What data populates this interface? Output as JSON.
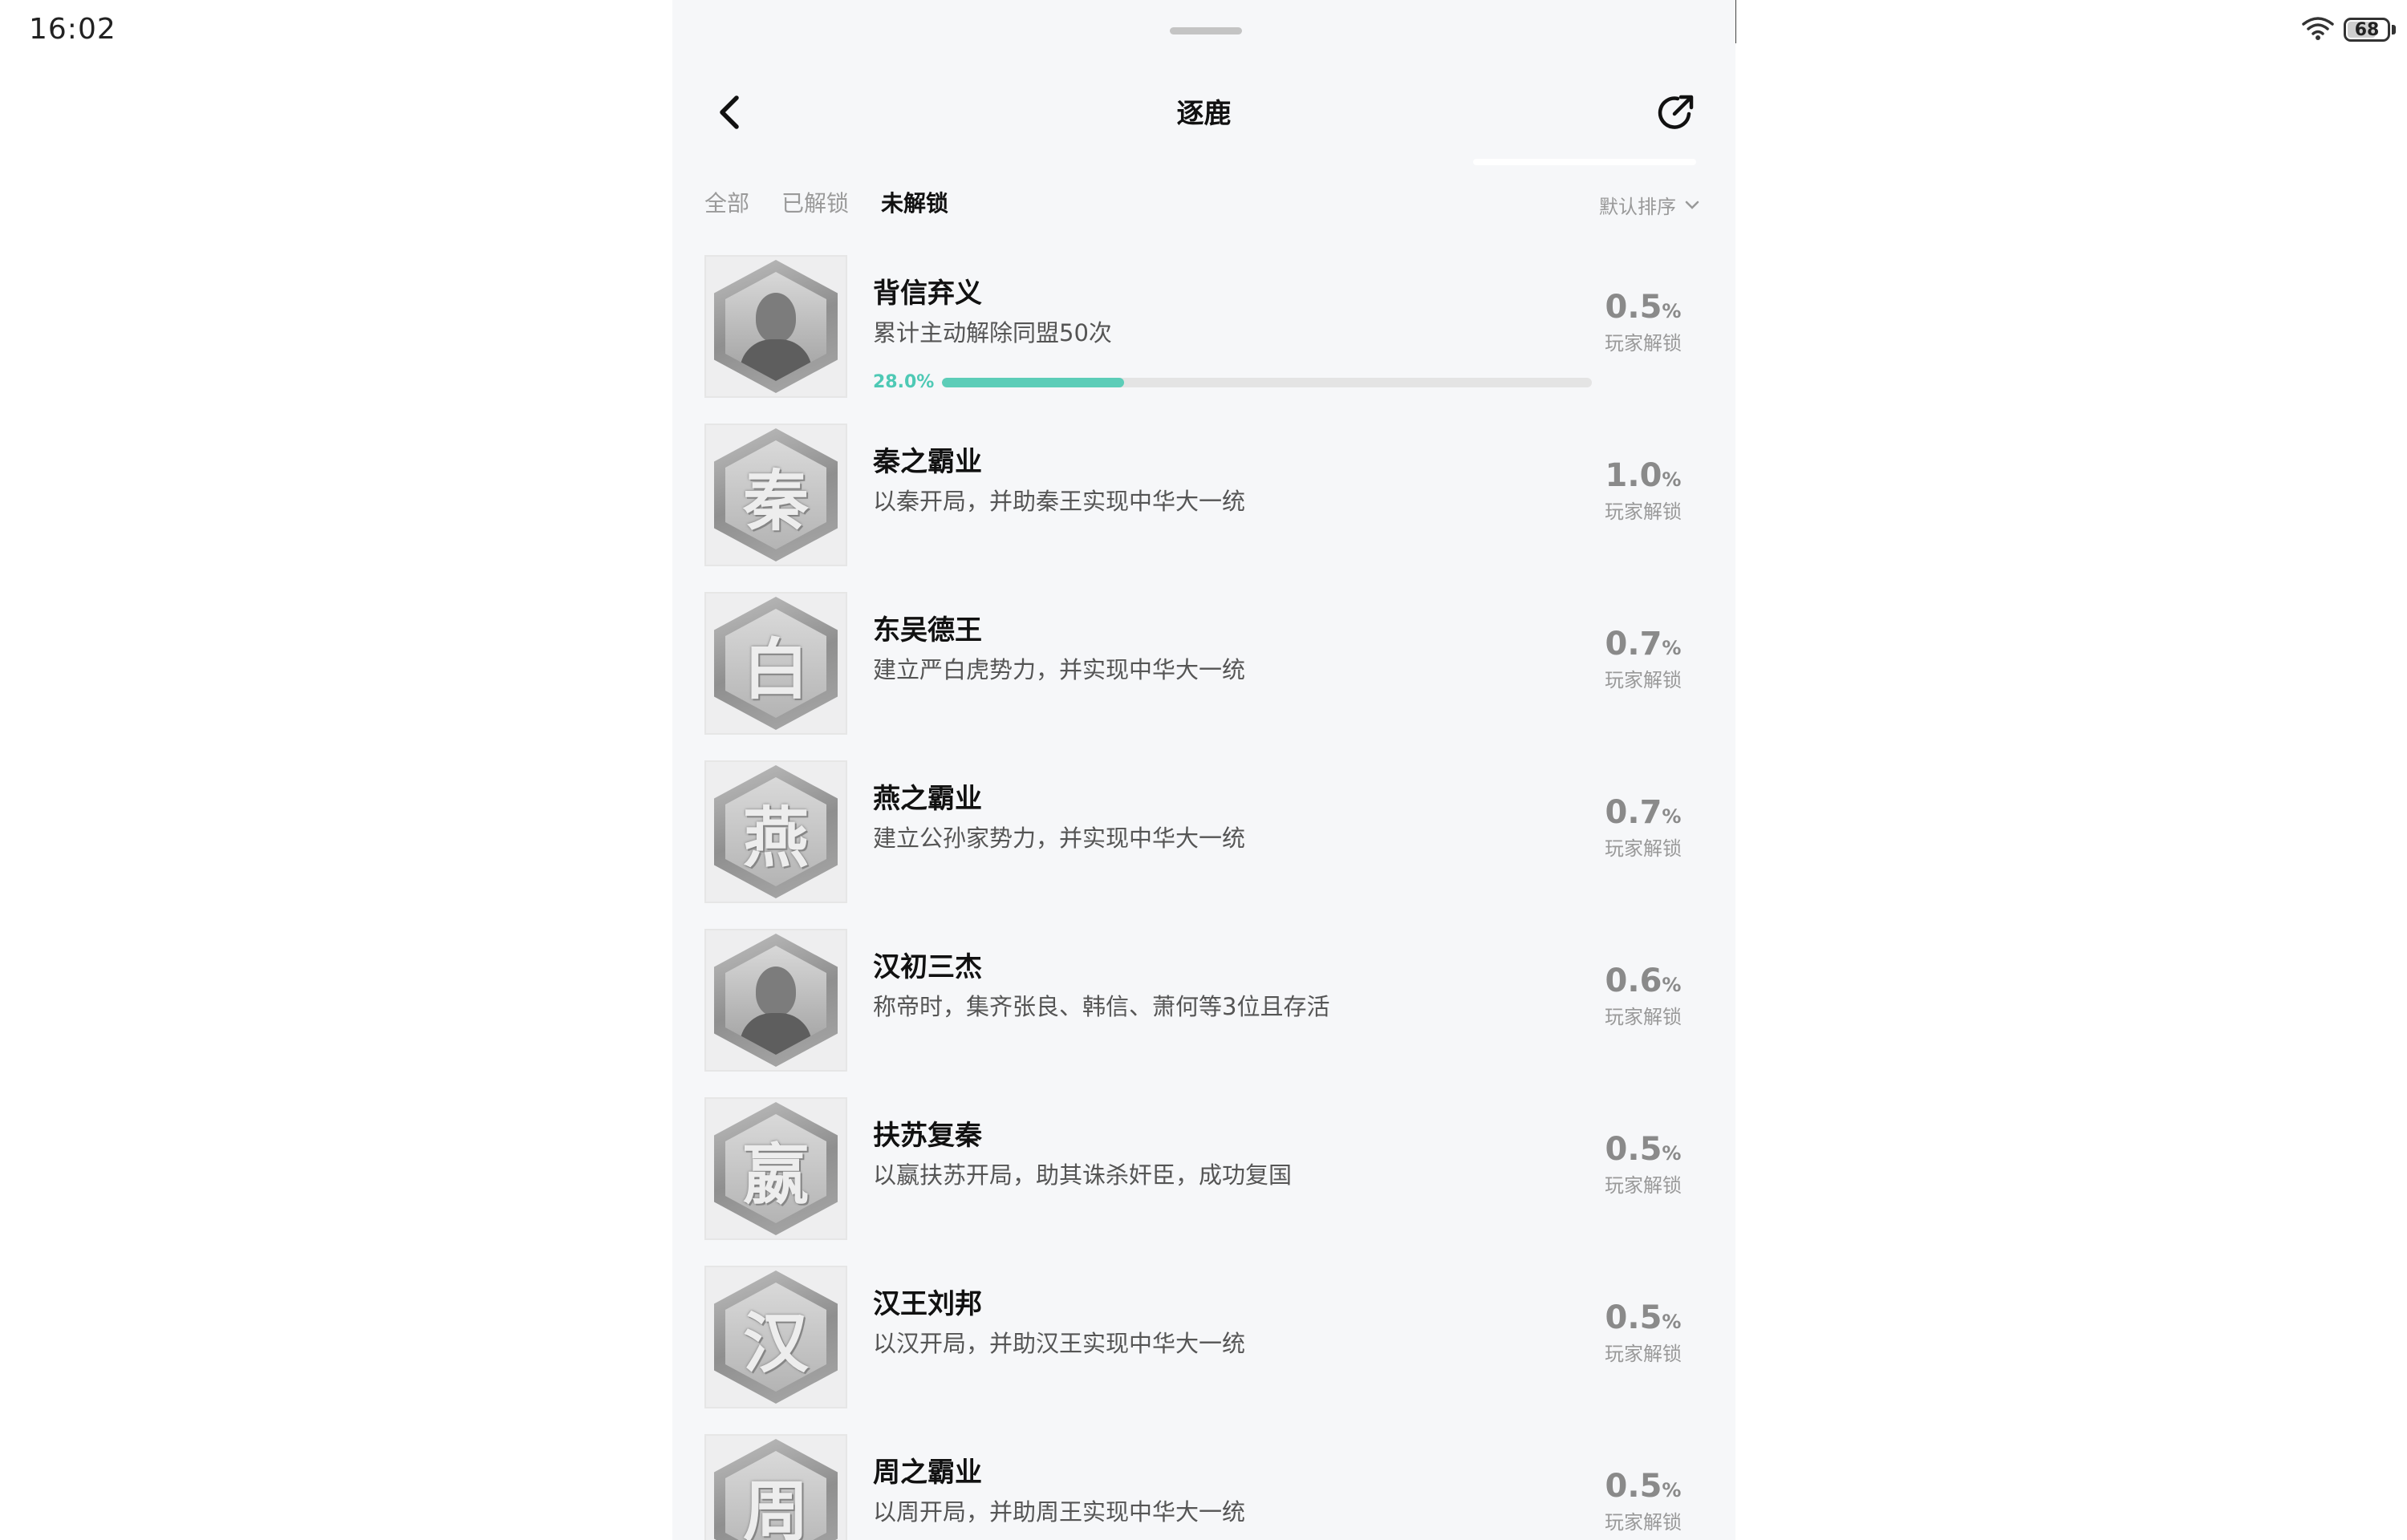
{
  "status_bar": {
    "time": "16:02",
    "battery": "68",
    "battery_level": 0.68
  },
  "header": {
    "title": "逐鹿"
  },
  "tabs": [
    {
      "label": "全部",
      "active": false
    },
    {
      "label": "已解锁",
      "active": false
    },
    {
      "label": "未解锁",
      "active": true
    }
  ],
  "sort": {
    "label": "默认排序"
  },
  "achievements": [
    {
      "title": "背信弃义",
      "desc": "累计主动解除同盟50次",
      "icon": "portrait-badge",
      "char": "",
      "rate": "0.5",
      "rate_unit": "%",
      "rate_label": "玩家解锁",
      "progress": "28.0%",
      "progress_value": 0.28
    },
    {
      "title": "秦之霸业",
      "desc": "以秦开局，并助秦王实现中华大一统",
      "icon": "character-badge",
      "char": "秦",
      "rate": "1.0",
      "rate_unit": "%",
      "rate_label": "玩家解锁"
    },
    {
      "title": "东吴德王",
      "desc": "建立严白虎势力，并实现中华大一统",
      "icon": "character-badge",
      "char": "白",
      "rate": "0.7",
      "rate_unit": "%",
      "rate_label": "玩家解锁"
    },
    {
      "title": "燕之霸业",
      "desc": "建立公孙家势力，并实现中华大一统",
      "icon": "character-badge",
      "char": "燕",
      "rate": "0.7",
      "rate_unit": "%",
      "rate_label": "玩家解锁"
    },
    {
      "title": "汉初三杰",
      "desc": "称帝时，集齐张良、韩信、萧何等3位且存活",
      "icon": "portrait-badge",
      "char": "",
      "rate": "0.6",
      "rate_unit": "%",
      "rate_label": "玩家解锁"
    },
    {
      "title": "扶苏复秦",
      "desc": "以嬴扶苏开局，助其诛杀奸臣，成功复国",
      "icon": "character-badge",
      "char": "嬴",
      "rate": "0.5",
      "rate_unit": "%",
      "rate_label": "玩家解锁"
    },
    {
      "title": "汉王刘邦",
      "desc": "以汉开局，并助汉王实现中华大一统",
      "icon": "character-badge",
      "char": "汉",
      "rate": "0.5",
      "rate_unit": "%",
      "rate_label": "玩家解锁"
    },
    {
      "title": "周之霸业",
      "desc": "以周开局，并助周王实现中华大一统",
      "icon": "character-badge",
      "char": "周",
      "rate": "0.5",
      "rate_unit": "%",
      "rate_label": "玩家解锁"
    }
  ]
}
